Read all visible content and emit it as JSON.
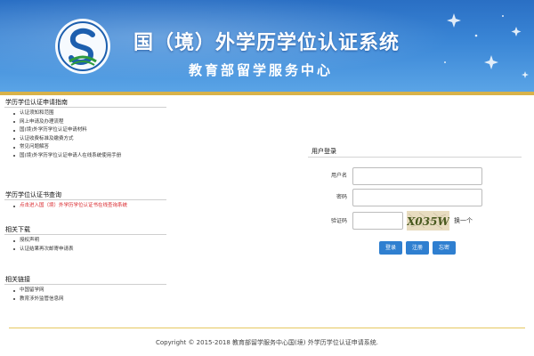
{
  "header": {
    "title": "国（境）外学历学位认证系统",
    "subtitle": "教育部留学服务中心"
  },
  "sections": [
    {
      "title": "学历学位认证申请指南",
      "items": [
        {
          "label": "认证须知和范围"
        },
        {
          "label": "网上申请及办理流程"
        },
        {
          "label": "国(境)外学历学位认证申请材料"
        },
        {
          "label": "认证收费标准及缴费方式"
        },
        {
          "label": "常见问题解答"
        },
        {
          "label": "国(境)外学历学位认证申请人在线系统使用手册"
        }
      ]
    },
    {
      "title": "学历学位认证书查询",
      "items": [
        {
          "label": "点击进入国（境）外学历学位认证书在线查询系统",
          "red": true
        }
      ]
    },
    {
      "title": "相关下载",
      "items": [
        {
          "label": "授权声明"
        },
        {
          "label": "认证结果再次邮寄申请表"
        }
      ]
    },
    {
      "title": "相关链接",
      "items": [
        {
          "label": "中国留学网"
        },
        {
          "label": "教育涉外监管信息网"
        }
      ]
    }
  ],
  "login": {
    "title": "用户登录",
    "username_label": "用户名",
    "username_value": "",
    "password_label": "密码",
    "password_value": "",
    "captcha_label": "验证码",
    "captcha_value": "",
    "captcha_text": "X035W",
    "change_label": "换一个",
    "buttons": {
      "login": "登录",
      "register": "注册",
      "forgot": "忘密"
    }
  },
  "footer": {
    "copyright": "Copyright © 2015-2018 教育部留学服务中心国(境) 外学历学位认证申请系统."
  },
  "colors": {
    "banner": "#3a86d6",
    "gold": "#d8b24a",
    "button": "#2f7fd0",
    "link_red": "#d9262b"
  }
}
